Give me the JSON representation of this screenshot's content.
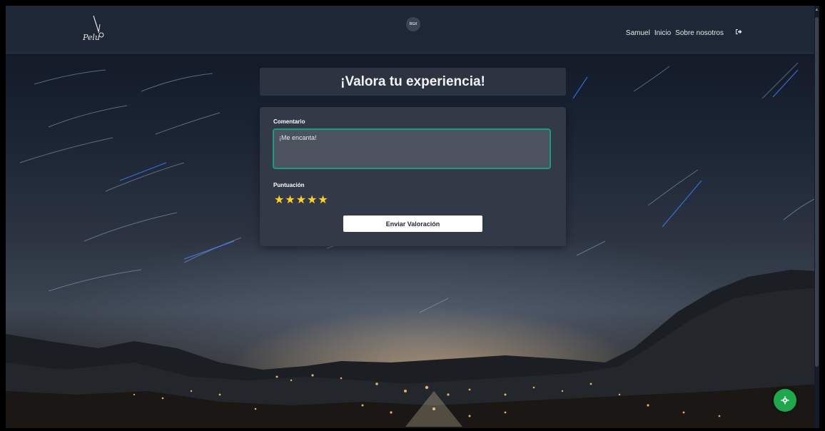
{
  "navbar": {
    "logo_text": "Pelu",
    "badge": "RGX",
    "links": [
      "Samuel",
      "Inicio",
      "Sobre nosotros"
    ],
    "logout_icon": "sign-out-icon"
  },
  "page": {
    "title": "¡Valora tu experiencia!"
  },
  "form": {
    "comment_label": "Comentario",
    "comment_value": "¡Me encanta!",
    "rating_label": "Puntuación",
    "rating": 5,
    "rating_max": 5,
    "star_glyphs": "★★★★★",
    "submit_label": "Enviar Valoración"
  },
  "floating": {
    "settings_icon": "gear-icon"
  },
  "colors": {
    "accent_border": "#1c9c7a",
    "star": "#ffd21f",
    "settings_button": "#1ea84c"
  }
}
